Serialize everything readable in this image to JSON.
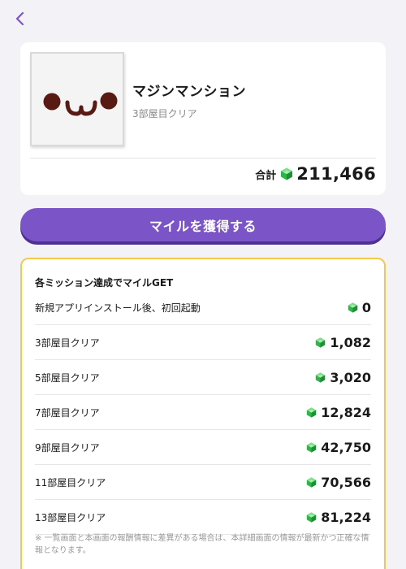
{
  "header": {
    "back_icon": "chevron-left-icon",
    "accent_color": "#7b55c7"
  },
  "game": {
    "title": "マジンマンション",
    "subtitle": "3部屋目クリア",
    "thumbnail_icon": "kaomoji-face-icon",
    "total_label": "合計",
    "total_value": "211,466",
    "currency_icon": "green-gem-icon"
  },
  "earn_button": {
    "label": "マイルを獲得する",
    "color": "#7b55c7"
  },
  "missions": {
    "heading": "各ミッション達成でマイルGET",
    "border_color": "#f2c94c",
    "items": [
      {
        "label": "新規アプリインストール後、初回起動",
        "value": "0"
      },
      {
        "label": "3部屋目クリア",
        "value": "1,082"
      },
      {
        "label": "5部屋目クリア",
        "value": "3,020"
      },
      {
        "label": "7部屋目クリア",
        "value": "12,824"
      },
      {
        "label": "9部屋目クリア",
        "value": "42,750"
      },
      {
        "label": "11部屋目クリア",
        "value": "70,566"
      },
      {
        "label": "13部屋目クリア",
        "value": "81,224"
      }
    ],
    "note": "※ 一覧画面と本画面の報酬情報に差異がある場合は、本詳細画面の情報が最新かつ正確な情報となります。"
  }
}
